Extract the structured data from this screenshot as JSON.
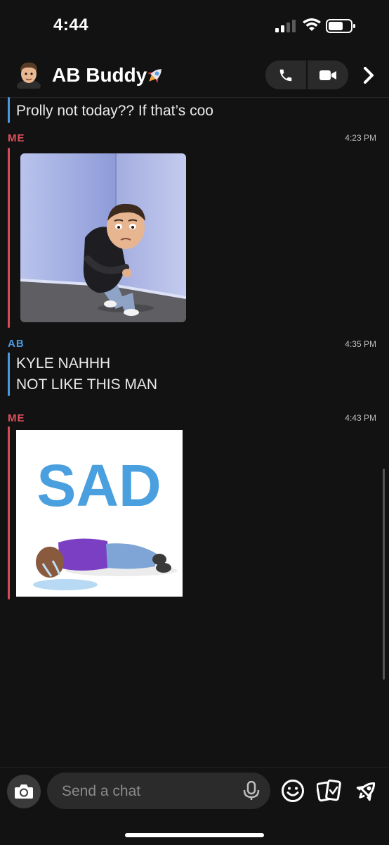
{
  "status_bar": {
    "time": "4:44"
  },
  "header": {
    "title": "AB Buddy"
  },
  "messages": [
    {
      "sender": "",
      "text": "Prolly not today?? If that’s coo"
    },
    {
      "sender": "ME",
      "time": "4:23 PM",
      "type": "bitmoji-sticker"
    },
    {
      "sender": "AB",
      "time": "4:35 PM",
      "lines": [
        "KYLE NAHHH",
        "NOT LIKE THIS MAN"
      ]
    },
    {
      "sender": "ME",
      "time": "4:43 PM",
      "type": "sticker",
      "sticker_text": "SAD"
    }
  ],
  "composer": {
    "placeholder": "Send a chat"
  },
  "colors": {
    "me": "#e0505c",
    "ab": "#4c98e0",
    "background": "#121212"
  }
}
